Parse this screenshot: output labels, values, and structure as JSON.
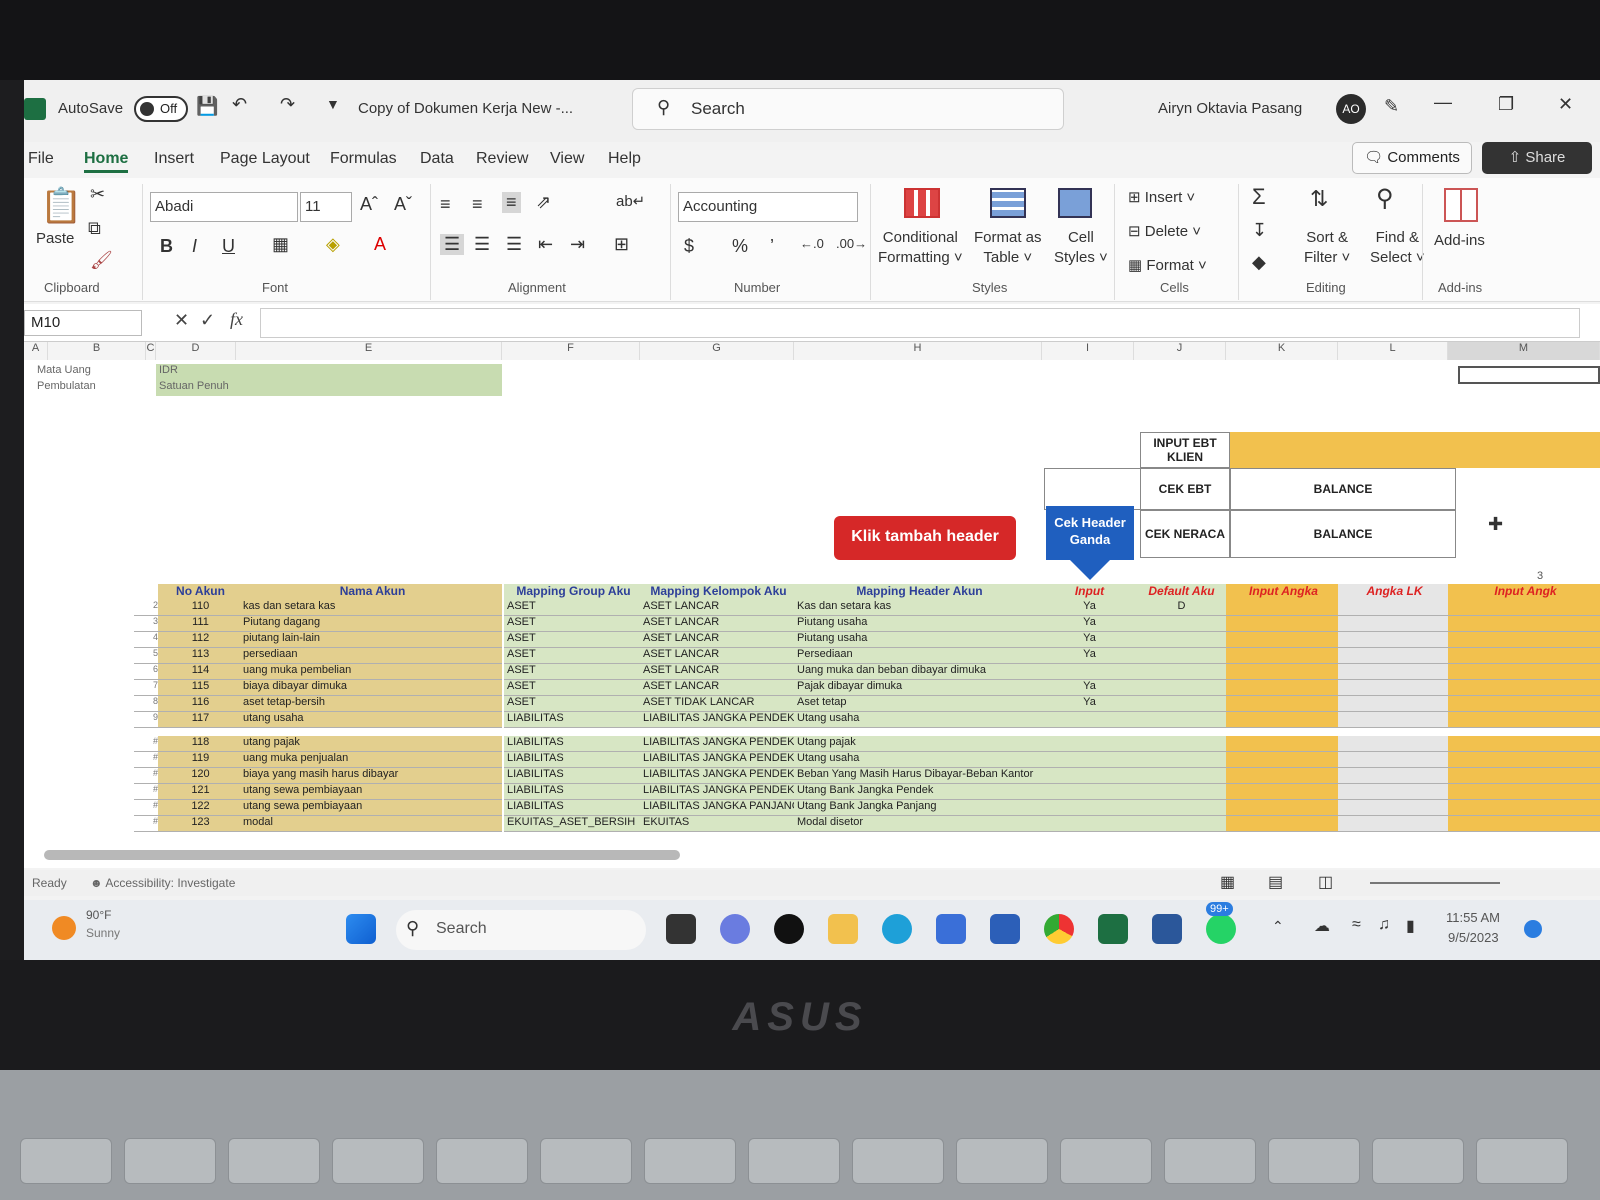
{
  "titlebar": {
    "autosave_label": "AutoSave",
    "autosave_state": "Off",
    "doc_title": "Copy of Dokumen Kerja New  -...",
    "search_placeholder": "Search",
    "user_name": "Airyn Oktavia Pasang",
    "user_initials": "AO"
  },
  "menu": {
    "tabs": [
      "File",
      "Home",
      "Insert",
      "Page Layout",
      "Formulas",
      "Data",
      "Review",
      "View",
      "Help"
    ],
    "active": "Home",
    "comments_label": "Comments",
    "share_label": "Share"
  },
  "ribbon": {
    "paste_label": "Paste",
    "font_name": "Abadi",
    "font_size": "11",
    "number_format": "Accounting",
    "conditional_formatting": "Conditional Formatting",
    "conditional_line1": "Conditional",
    "conditional_line2": "Formatting",
    "format_as_table_line1": "Format as",
    "format_as_table_line2": "Table",
    "cell_styles_line1": "Cell",
    "cell_styles_line2": "Styles",
    "insert_label": "Insert",
    "delete_label": "Delete",
    "format_label": "Format",
    "sort_line1": "Sort &",
    "sort_line2": "Filter",
    "find_line1": "Find &",
    "find_line2": "Select",
    "addins_label": "Add-ins",
    "groups": [
      "Clipboard",
      "Font",
      "Alignment",
      "Number",
      "Styles",
      "Cells",
      "Editing",
      "Add-ins"
    ]
  },
  "formula_bar": {
    "name_box": "M10",
    "fx": "fx"
  },
  "sheet": {
    "columns": [
      "A",
      "B",
      "C",
      "D",
      "E",
      "F",
      "G",
      "H",
      "I",
      "J",
      "K",
      "L",
      "M"
    ],
    "top_rows": [
      {
        "label": "Mata Uang",
        "value": "IDR"
      },
      {
        "label": "Pembulatan",
        "value": "Satuan Penuh"
      }
    ],
    "check_box": {
      "input_ebt_klien": "INPUT EBT KLIEN",
      "cek_ebt": "CEK EBT",
      "cek_ebt_result": "BALANCE",
      "cek_neraca": "CEK NERACA",
      "cek_neraca_result": "BALANCE",
      "counter": "3"
    },
    "btn_tambah_header": "Klik tambah header",
    "btn_cek_header": "Cek Header Ganda",
    "headers": {
      "no_akun": "No Akun",
      "nama_akun": "Nama Akun",
      "mapping_group": "Mapping Group Aku",
      "mapping_kelompok": "Mapping Kelompok Aku",
      "mapping_header": "Mapping Header Akun",
      "input": "Input",
      "default": "Default Aku",
      "input_angka": "Input Angka",
      "angka_lk": "Angka LK",
      "input_angka2": "Input Angk"
    },
    "rows": [
      {
        "r": "2",
        "no": "110",
        "nama": "kas dan setara kas",
        "group": "ASET",
        "kelompok": "ASET LANCAR",
        "header": "Kas dan setara kas",
        "input": "Ya",
        "def": "D"
      },
      {
        "r": "3",
        "no": "111",
        "nama": "Piutang dagang",
        "group": "ASET",
        "kelompok": "ASET LANCAR",
        "header": "Piutang usaha",
        "input": "Ya",
        "def": ""
      },
      {
        "r": "4",
        "no": "112",
        "nama": "piutang lain-lain",
        "group": "ASET",
        "kelompok": "ASET LANCAR",
        "header": "Piutang usaha",
        "input": "Ya",
        "def": ""
      },
      {
        "r": "5",
        "no": "113",
        "nama": "persediaan",
        "group": "ASET",
        "kelompok": "ASET LANCAR",
        "header": "Persediaan",
        "input": "Ya",
        "def": ""
      },
      {
        "r": "6",
        "no": "114",
        "nama": "uang muka pembelian",
        "group": "ASET",
        "kelompok": "ASET LANCAR",
        "header": "Uang muka dan beban dibayar dimuka",
        "input": "",
        "def": ""
      },
      {
        "r": "7",
        "no": "115",
        "nama": "biaya dibayar dimuka",
        "group": "ASET",
        "kelompok": "ASET LANCAR",
        "header": "Pajak dibayar dimuka",
        "input": "Ya",
        "def": ""
      },
      {
        "r": "8",
        "no": "116",
        "nama": "aset tetap-bersih",
        "group": "ASET",
        "kelompok": "ASET TIDAK LANCAR",
        "header": "Aset tetap",
        "input": "Ya",
        "def": ""
      },
      {
        "r": "9",
        "no": "117",
        "nama": "utang usaha",
        "group": "LIABILITAS",
        "kelompok": "LIABILITAS JANGKA PENDEK",
        "header": "Utang usaha",
        "input": "",
        "def": ""
      },
      {
        "r": "#",
        "no": "118",
        "nama": "utang pajak",
        "group": "LIABILITAS",
        "kelompok": "LIABILITAS JANGKA PENDEK",
        "header": "Utang pajak",
        "input": "",
        "def": ""
      },
      {
        "r": "#",
        "no": "119",
        "nama": "uang muka penjualan",
        "group": "LIABILITAS",
        "kelompok": "LIABILITAS JANGKA PENDEK",
        "header": "Utang usaha",
        "input": "",
        "def": ""
      },
      {
        "r": "#",
        "no": "120",
        "nama": "biaya yang masih harus dibayar",
        "group": "LIABILITAS",
        "kelompok": "LIABILITAS JANGKA PENDEK",
        "header": "Beban Yang Masih Harus Dibayar-Beban Kantor",
        "input": "",
        "def": ""
      },
      {
        "r": "#",
        "no": "121",
        "nama": "utang sewa pembiayaan",
        "group": "LIABILITAS",
        "kelompok": "LIABILITAS JANGKA PENDEK",
        "header": "Utang Bank Jangka Pendek",
        "input": "",
        "def": ""
      },
      {
        "r": "#",
        "no": "122",
        "nama": "utang sewa pembiayaan",
        "group": "LIABILITAS",
        "kelompok": "LIABILITAS JANGKA PANJANG",
        "header": "Utang Bank Jangka Panjang",
        "input": "",
        "def": ""
      },
      {
        "r": "#",
        "no": "123",
        "nama": "modal",
        "group": "EKUITAS_ASET_BERSIH",
        "kelompok": "EKUITAS",
        "header": "Modal disetor",
        "input": "",
        "def": ""
      }
    ]
  },
  "status": {
    "ready": "Ready",
    "accessibility": "Accessibility: Investigate"
  },
  "taskbar": {
    "weather_temp": "90°F",
    "weather_desc": "Sunny",
    "search_placeholder": "Search",
    "whatsapp_badge": "99+",
    "time": "11:55 AM",
    "date": "9/5/2023"
  },
  "laptop": {
    "brand": "ASUS"
  }
}
